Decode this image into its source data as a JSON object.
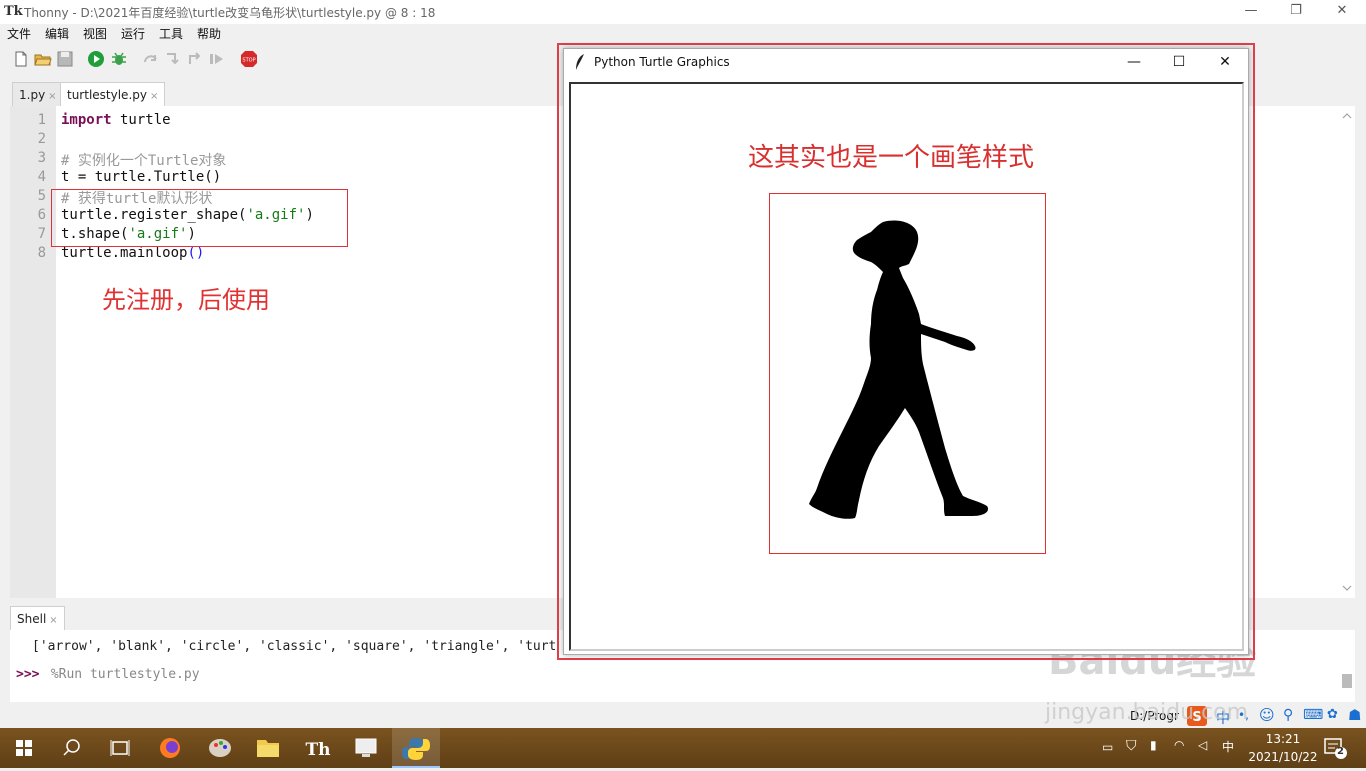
{
  "window": {
    "title": "Thonny  -  D:\\2021年百度经验\\turtle改变乌龟形状\\turtlestyle.py  @  8 : 18",
    "app_icon_text": "Tk",
    "minimize": "—",
    "maximize": "❐",
    "close": "✕"
  },
  "menu": [
    "文件",
    "编辑",
    "视图",
    "运行",
    "工具",
    "帮助"
  ],
  "toolbar": {
    "icons": [
      "new-file-icon",
      "open-file-icon",
      "save-icon",
      "run-icon",
      "debug-icon",
      "step-over-icon",
      "step-into-icon",
      "step-out-icon",
      "resume-icon",
      "stop-icon"
    ],
    "stop_label": "STOP"
  },
  "tabs": [
    {
      "label": "1.py",
      "close": "×"
    },
    {
      "label": "turtlestyle.py",
      "close": "×"
    }
  ],
  "editor": {
    "line_numbers": [
      "1",
      "2",
      "3",
      "4",
      "5",
      "6",
      "7",
      "8"
    ],
    "lines": [
      {
        "kw": "import",
        "rest": " turtle"
      },
      {
        "text": ""
      },
      {
        "comment": "# 实例化一个Turtle对象"
      },
      {
        "text": "t = turtle.Turtle()"
      },
      {
        "comment": "# 获得turtle默认形状"
      },
      {
        "pre": "turtle.register_shape(",
        "str": "'a.gif'",
        "post": ")"
      },
      {
        "pre": "t.shape(",
        "str": "'a.gif'",
        "post": ")"
      },
      {
        "pre": "turtle.mainloop",
        "paren": "()"
      }
    ],
    "annotation": "先注册，后使用"
  },
  "shell": {
    "tab_label": "Shell",
    "tab_close": "×",
    "output_line": "['arrow', 'blank', 'circle', 'classic', 'square', 'triangle', 'turt",
    "prompt": ">>>",
    "command": " %Run turtlestyle.py"
  },
  "turtle_window": {
    "title": "Python Turtle Graphics",
    "minimize": "—",
    "maximize": "☐",
    "close": "✕",
    "annotation": "这其实也是一个画笔样式"
  },
  "statusbar": {
    "path": "D:/Progr"
  },
  "taskbar": {
    "apps": [
      "windows-start-icon",
      "search-icon",
      "task-view-icon",
      "firefox-icon",
      "paint-icon",
      "file-explorer-icon",
      "thonny-icon",
      "remote-desktop-icon",
      "python-icon"
    ],
    "time": "13:21",
    "date": "2021/10/22",
    "ime": "中",
    "notifications": "2"
  },
  "watermark": {
    "text": "Baidu经验",
    "sub": "jingyan.baidu.com"
  },
  "colors": {
    "annotation_red": "#e03232",
    "keyword": "#7a0f55",
    "string": "#167a16",
    "comment": "#999999"
  }
}
